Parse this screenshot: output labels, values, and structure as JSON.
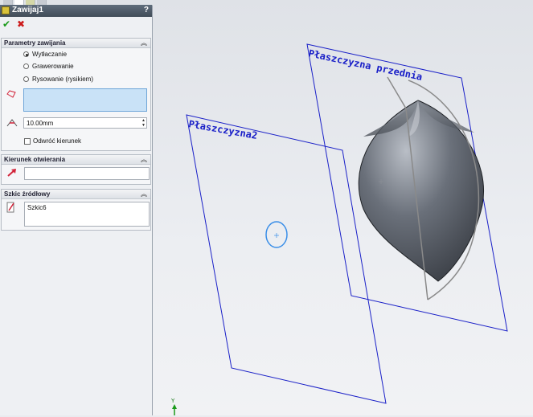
{
  "feature": {
    "title": "Zawijaj1",
    "help": "?"
  },
  "groups": {
    "params": {
      "title": "Parametry zawijania",
      "options": [
        "Wytłaczanie",
        "Grawerowanie",
        "Rysowanie (rysikiem)"
      ],
      "selected_index": 0,
      "thickness": "10.00mm",
      "reverse_label": "Odwróć kierunek",
      "reverse_checked": false
    },
    "direction": {
      "title": "Kierunek otwierania",
      "value": ""
    },
    "source": {
      "title": "Szkic źródłowy",
      "value": "Szkic6"
    }
  },
  "viewport": {
    "plane_front_label": "Płaszczyzna przednia",
    "plane2_label": "Płaszczyzna2",
    "triad_label": "Y",
    "colors": {
      "plane": "#1a20c8",
      "sketch_circle": "#3a8ee8",
      "body": "#4e535c"
    }
  },
  "icons": [
    "feature-icon",
    "ok-check-icon",
    "cancel-x-icon",
    "face-select-icon",
    "thickness-icon",
    "direction-arrow-icon",
    "sketch-icon",
    "collapse-chevron-icon",
    "triad-icon"
  ]
}
